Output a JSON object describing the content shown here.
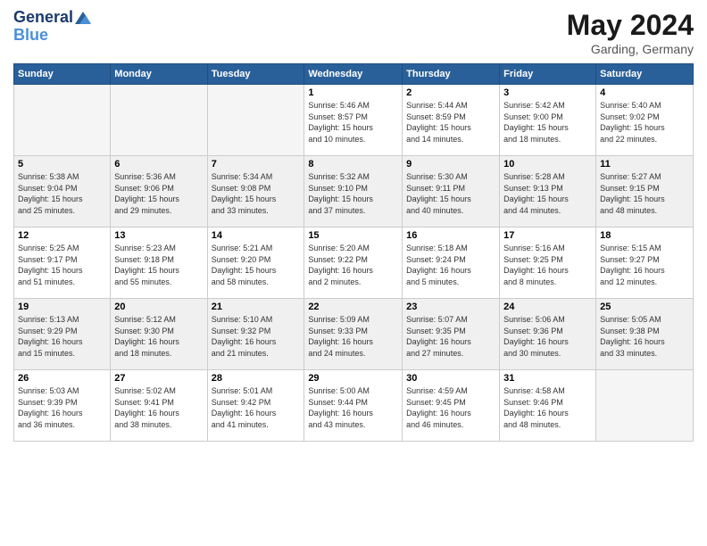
{
  "header": {
    "logo_line1": "General",
    "logo_line2": "Blue",
    "month_year": "May 2024",
    "location": "Garding, Germany"
  },
  "days_of_week": [
    "Sunday",
    "Monday",
    "Tuesday",
    "Wednesday",
    "Thursday",
    "Friday",
    "Saturday"
  ],
  "weeks": [
    [
      {
        "day": "",
        "info": ""
      },
      {
        "day": "",
        "info": ""
      },
      {
        "day": "",
        "info": ""
      },
      {
        "day": "1",
        "info": "Sunrise: 5:46 AM\nSunset: 8:57 PM\nDaylight: 15 hours\nand 10 minutes."
      },
      {
        "day": "2",
        "info": "Sunrise: 5:44 AM\nSunset: 8:59 PM\nDaylight: 15 hours\nand 14 minutes."
      },
      {
        "day": "3",
        "info": "Sunrise: 5:42 AM\nSunset: 9:00 PM\nDaylight: 15 hours\nand 18 minutes."
      },
      {
        "day": "4",
        "info": "Sunrise: 5:40 AM\nSunset: 9:02 PM\nDaylight: 15 hours\nand 22 minutes."
      }
    ],
    [
      {
        "day": "5",
        "info": "Sunrise: 5:38 AM\nSunset: 9:04 PM\nDaylight: 15 hours\nand 25 minutes."
      },
      {
        "day": "6",
        "info": "Sunrise: 5:36 AM\nSunset: 9:06 PM\nDaylight: 15 hours\nand 29 minutes."
      },
      {
        "day": "7",
        "info": "Sunrise: 5:34 AM\nSunset: 9:08 PM\nDaylight: 15 hours\nand 33 minutes."
      },
      {
        "day": "8",
        "info": "Sunrise: 5:32 AM\nSunset: 9:10 PM\nDaylight: 15 hours\nand 37 minutes."
      },
      {
        "day": "9",
        "info": "Sunrise: 5:30 AM\nSunset: 9:11 PM\nDaylight: 15 hours\nand 40 minutes."
      },
      {
        "day": "10",
        "info": "Sunrise: 5:28 AM\nSunset: 9:13 PM\nDaylight: 15 hours\nand 44 minutes."
      },
      {
        "day": "11",
        "info": "Sunrise: 5:27 AM\nSunset: 9:15 PM\nDaylight: 15 hours\nand 48 minutes."
      }
    ],
    [
      {
        "day": "12",
        "info": "Sunrise: 5:25 AM\nSunset: 9:17 PM\nDaylight: 15 hours\nand 51 minutes."
      },
      {
        "day": "13",
        "info": "Sunrise: 5:23 AM\nSunset: 9:18 PM\nDaylight: 15 hours\nand 55 minutes."
      },
      {
        "day": "14",
        "info": "Sunrise: 5:21 AM\nSunset: 9:20 PM\nDaylight: 15 hours\nand 58 minutes."
      },
      {
        "day": "15",
        "info": "Sunrise: 5:20 AM\nSunset: 9:22 PM\nDaylight: 16 hours\nand 2 minutes."
      },
      {
        "day": "16",
        "info": "Sunrise: 5:18 AM\nSunset: 9:24 PM\nDaylight: 16 hours\nand 5 minutes."
      },
      {
        "day": "17",
        "info": "Sunrise: 5:16 AM\nSunset: 9:25 PM\nDaylight: 16 hours\nand 8 minutes."
      },
      {
        "day": "18",
        "info": "Sunrise: 5:15 AM\nSunset: 9:27 PM\nDaylight: 16 hours\nand 12 minutes."
      }
    ],
    [
      {
        "day": "19",
        "info": "Sunrise: 5:13 AM\nSunset: 9:29 PM\nDaylight: 16 hours\nand 15 minutes."
      },
      {
        "day": "20",
        "info": "Sunrise: 5:12 AM\nSunset: 9:30 PM\nDaylight: 16 hours\nand 18 minutes."
      },
      {
        "day": "21",
        "info": "Sunrise: 5:10 AM\nSunset: 9:32 PM\nDaylight: 16 hours\nand 21 minutes."
      },
      {
        "day": "22",
        "info": "Sunrise: 5:09 AM\nSunset: 9:33 PM\nDaylight: 16 hours\nand 24 minutes."
      },
      {
        "day": "23",
        "info": "Sunrise: 5:07 AM\nSunset: 9:35 PM\nDaylight: 16 hours\nand 27 minutes."
      },
      {
        "day": "24",
        "info": "Sunrise: 5:06 AM\nSunset: 9:36 PM\nDaylight: 16 hours\nand 30 minutes."
      },
      {
        "day": "25",
        "info": "Sunrise: 5:05 AM\nSunset: 9:38 PM\nDaylight: 16 hours\nand 33 minutes."
      }
    ],
    [
      {
        "day": "26",
        "info": "Sunrise: 5:03 AM\nSunset: 9:39 PM\nDaylight: 16 hours\nand 36 minutes."
      },
      {
        "day": "27",
        "info": "Sunrise: 5:02 AM\nSunset: 9:41 PM\nDaylight: 16 hours\nand 38 minutes."
      },
      {
        "day": "28",
        "info": "Sunrise: 5:01 AM\nSunset: 9:42 PM\nDaylight: 16 hours\nand 41 minutes."
      },
      {
        "day": "29",
        "info": "Sunrise: 5:00 AM\nSunset: 9:44 PM\nDaylight: 16 hours\nand 43 minutes."
      },
      {
        "day": "30",
        "info": "Sunrise: 4:59 AM\nSunset: 9:45 PM\nDaylight: 16 hours\nand 46 minutes."
      },
      {
        "day": "31",
        "info": "Sunrise: 4:58 AM\nSunset: 9:46 PM\nDaylight: 16 hours\nand 48 minutes."
      },
      {
        "day": "",
        "info": ""
      }
    ]
  ]
}
